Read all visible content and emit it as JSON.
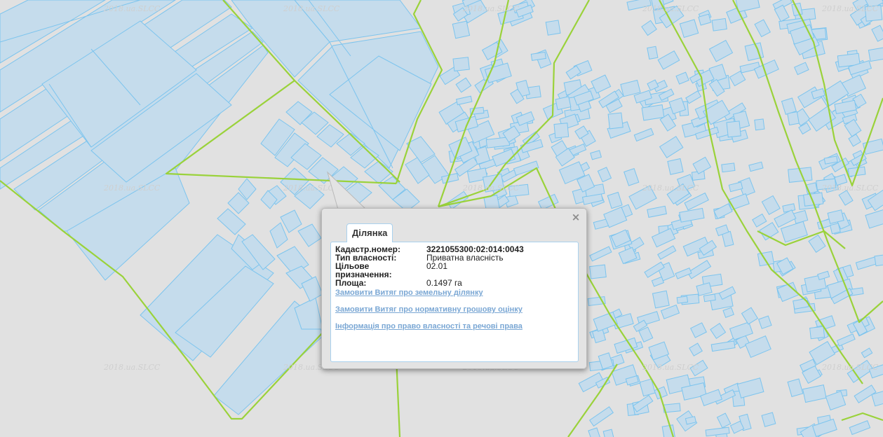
{
  "map": {
    "watermark": "2018.ua.SLCC",
    "colors": {
      "background": "#e1e1e1",
      "parcel_fill": "#c5dcec",
      "parcel_stroke": "#7cc4ee",
      "boundary": "#9ad23a"
    }
  },
  "popup": {
    "close_icon": "×",
    "tab_label": "Ділянка",
    "attributes": [
      {
        "key": "Кадастр.номер:",
        "value": "3221055300:02:014:0043"
      },
      {
        "key": "Тип власності:",
        "value": "Приватна власність"
      },
      {
        "key": "Цільове призначення:",
        "value": "02.01"
      },
      {
        "key": "Площа:",
        "value": "0.1497 га"
      }
    ],
    "links": [
      "Замовити Витяг про земельну ділянку",
      "Замовити Витяг про нормативну грошову оцінку",
      "Інформація про право власності та речові права"
    ]
  }
}
